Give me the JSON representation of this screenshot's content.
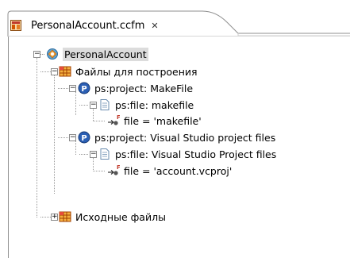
{
  "tab": {
    "title": "PersonalAccount.ccfm",
    "close_glyph": "✕",
    "icon": "ccfm-file-icon"
  },
  "tree": {
    "root": {
      "label": "PersonalAccount",
      "icon": "component-icon",
      "expanded": true
    },
    "build_files": {
      "label": "Файлы для построения",
      "icon": "folder-grid-icon",
      "expanded": true
    },
    "project_makefile": {
      "label": "ps:project: MakeFile",
      "icon": "project-p-icon",
      "expanded": true
    },
    "file_makefile": {
      "label": "ps:file: makefile",
      "icon": "document-icon",
      "expanded": true
    },
    "attr_makefile": {
      "label": "file = 'makefile'",
      "icon": "attribute-f-icon"
    },
    "project_vs": {
      "label": "ps:project: Visual Studio project files",
      "icon": "project-p-icon",
      "expanded": true
    },
    "file_vs": {
      "label": "ps:file: Visual Studio Project files",
      "icon": "document-icon",
      "expanded": true
    },
    "attr_vs": {
      "label": "file = 'account.vcproj'",
      "icon": "attribute-f-icon"
    },
    "source_files": {
      "label": "Исходные файлы",
      "icon": "folder-grid-icon",
      "expanded": false
    }
  },
  "colors": {
    "folder_orange": "#e8901e",
    "project_blue": "#2b5fb4",
    "selection_gray": "#dcdcdc",
    "guide_gray": "#9a9a9a"
  }
}
